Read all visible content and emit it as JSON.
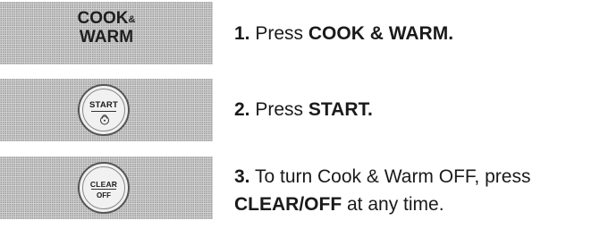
{
  "steps": [
    {
      "button": {
        "line1": "COOK",
        "amp": "&",
        "line2": "WARM"
      },
      "number": "1.",
      "text_before": "Press",
      "bold": "COOK & WARM.",
      "text_after": ""
    },
    {
      "button": {
        "top_label": "START",
        "bottom_icon": "lock-icon"
      },
      "number": "2.",
      "text_before": "Press",
      "bold": "START.",
      "text_after": ""
    },
    {
      "button": {
        "top_label": "CLEAR",
        "bottom_label": "OFF"
      },
      "number": "3.",
      "text_before": "To turn Cook & Warm OFF, press",
      "bold": "CLEAR/OFF",
      "text_after": "at any time."
    }
  ]
}
